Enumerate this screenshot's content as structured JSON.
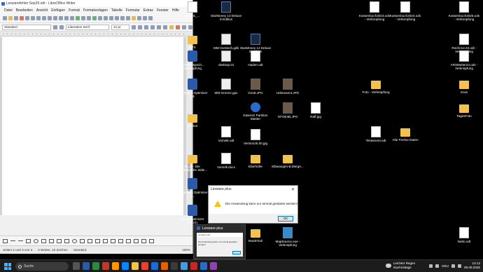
{
  "writer": {
    "title": "Lexwarefehler Sep25.odt - LibreOffice Writer",
    "menu": [
      "Datei",
      "Bearbeiten",
      "Ansicht",
      "Einfügen",
      "Format",
      "Formatvorlagen",
      "Tabelle",
      "Formular",
      "Extras",
      "Fenster",
      "Hilfe"
    ],
    "style": "Standard",
    "font": "Liberation Serif",
    "size": "12 pt",
    "status": {
      "page": "Seiten 2 und 3 von 3",
      "words": "3 Wörter, 23 Zeichen",
      "style": "Standard",
      "zoom": "100%"
    }
  },
  "desktop_icons": [
    {
      "label": "ks2001_...",
      "kind": "doc"
    },
    {
      "label": "StarMoney 13 Deluxe S-Edition",
      "kind": "dark"
    },
    {
      "label": "Kassenbuch2023.ods - Verknüpfung",
      "kind": "doc"
    },
    {
      "label": "Kassenbuch2024.ods - Verknüpfung",
      "kind": "doc"
    },
    {
      "label": "Kassenbuch2025.ods - Verknüpfung",
      "kind": "doc"
    },
    {
      "label": "GFX",
      "kind": "folder"
    },
    {
      "label": "MM-Vorstech.gdb",
      "kind": "db"
    },
    {
      "label": "StarMoney 14 Deluxe S-Edition",
      "kind": "dark"
    },
    {
      "label": "Rechn12.22.odt - Verknüpfung",
      "kind": "doc"
    },
    {
      "label": "Lexwarespech... Verknüpfung",
      "kind": "app"
    },
    {
      "label": "desktop.ini",
      "kind": "db"
    },
    {
      "label": "Haden.odt",
      "kind": "doc"
    },
    {
      "label": "ARSMeiter24.ods - Verknüpfung",
      "kind": "doc"
    },
    {
      "label": "Ashampoo Optimizer 19",
      "kind": "app"
    },
    {
      "label": "MM-Grenze.gpx",
      "kind": "db"
    },
    {
      "label": "Gnott.JPG",
      "kind": "photo"
    },
    {
      "label": "Unbenannt.JPG",
      "kind": "photo"
    },
    {
      "label": "Foto - Verknüpfung",
      "kind": "folder"
    },
    {
      "label": "Scan",
      "kind": "folder"
    },
    {
      "label": "EaseUS Partition Master",
      "kind": "cam"
    },
    {
      "label": "GFOE4B.JPG",
      "kind": "photo"
    },
    {
      "label": "Raff.jpg",
      "kind": "doc"
    },
    {
      "label": "TagesFoto",
      "kind": "folder"
    },
    {
      "label": "IrisTour",
      "kind": "folder"
    },
    {
      "label": "Vomelk.odt",
      "kind": "doc"
    },
    {
      "label": "Testament.odt",
      "kind": "doc"
    },
    {
      "label": "Alte Firefox-Daten",
      "kind": "folder"
    },
    {
      "label": "Version25.00.jpg",
      "kind": "doc"
    },
    {
      "label": "Buch - Die Schwäbische Skile...",
      "kind": "folder"
    },
    {
      "label": "Vomelk.docx",
      "kind": "doc"
    },
    {
      "label": "Eberhofer",
      "kind": "folder"
    },
    {
      "label": "Elbwangen-B.Merge...",
      "kind": "folder"
    },
    {
      "label": "Ashampoo Optimizer 2...",
      "kind": "app"
    },
    {
      "label": "Quick-Optimizer (WUS)",
      "kind": "app"
    },
    {
      "label": "MusikTool",
      "kind": "folder"
    },
    {
      "label": "MapSource.exe - Verknüpfung",
      "kind": "map"
    },
    {
      "label": "Netto.odt",
      "kind": "doc"
    }
  ],
  "dialog": {
    "title": "Lexware plus",
    "close": "✕",
    "message": "Die Anwendung kann nur einmal gestartet werden!",
    "ok": "OK"
  },
  "thumbnail": {
    "title": "Lexware plus",
    "preview_title": "Lexware plus",
    "preview_message": "Die Anwendung kann nur einmal gestartet werden!"
  },
  "taskbar": {
    "search": "Suche",
    "weather_line1": "Leichter Regen",
    "weather_line2": "Nachmittags",
    "lang": "DEU",
    "time": "13:12",
    "date": "09.09.2025"
  },
  "colors": {
    "desktop": "#000000",
    "accent": "#0078d4",
    "warn": "#f5c518"
  }
}
